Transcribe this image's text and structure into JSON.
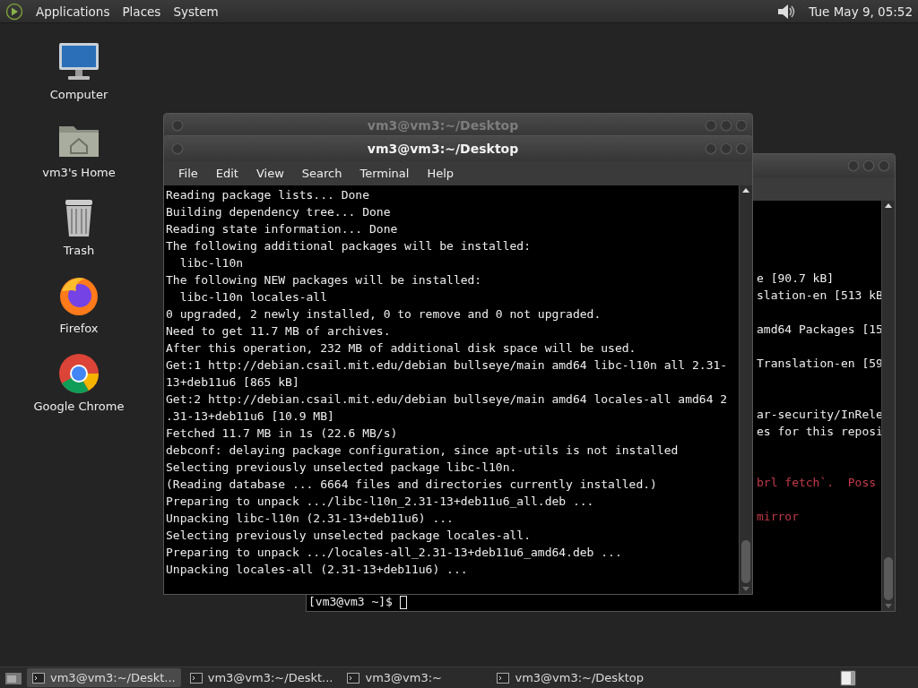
{
  "top_panel": {
    "menus": [
      "Applications",
      "Places",
      "System"
    ],
    "clock": "Tue May 9, 05:52"
  },
  "desktop_icons": [
    {
      "label": "Computer",
      "kind": "computer"
    },
    {
      "label": "vm3's Home",
      "kind": "home"
    },
    {
      "label": "Trash",
      "kind": "trash"
    },
    {
      "label": "Firefox",
      "kind": "firefox"
    },
    {
      "label": "Google Chrome",
      "kind": "chrome"
    }
  ],
  "back_terminal": {
    "lines": [
      {
        "text": "e [90.7 kB]",
        "kind": "normal"
      },
      {
        "text": "slation-en [513 kB",
        "kind": "normal"
      },
      {
        "kind": "blank"
      },
      {
        "text": "amd64 Packages [15",
        "kind": "normal"
      },
      {
        "kind": "blank"
      },
      {
        "text": "Translation-en [59",
        "kind": "normal"
      },
      {
        "kind": "blank"
      },
      {
        "kind": "blank"
      },
      {
        "text": "ar-security/InRele",
        "kind": "normal"
      },
      {
        "text": "es for this reposi",
        "kind": "normal"
      },
      {
        "kind": "blank"
      },
      {
        "kind": "blank"
      },
      {
        "text": "brl fetch`.  Poss",
        "kind": "error"
      },
      {
        "kind": "blank"
      },
      {
        "text": "mirror",
        "kind": "error"
      },
      {
        "kind": "blank"
      },
      {
        "kind": "blank"
      },
      {
        "kind": "blank"
      },
      {
        "kind": "blank"
      }
    ],
    "prompt": "[vm3@vm3 ~]$"
  },
  "middle_window": {
    "title": "vm3@vm3:~/Desktop",
    "focused": false
  },
  "front_terminal": {
    "title": "vm3@vm3:~/Desktop",
    "focused": true,
    "menu": [
      "File",
      "Edit",
      "View",
      "Search",
      "Terminal",
      "Help"
    ],
    "lines": [
      "Reading package lists... Done",
      "Building dependency tree... Done",
      "Reading state information... Done",
      "The following additional packages will be installed:",
      "  libc-l10n",
      "The following NEW packages will be installed:",
      "  libc-l10n locales-all",
      "0 upgraded, 2 newly installed, 0 to remove and 0 not upgraded.",
      "Need to get 11.7 MB of archives.",
      "After this operation, 232 MB of additional disk space will be used.",
      "Get:1 http://debian.csail.mit.edu/debian bullseye/main amd64 libc-l10n all 2.31-",
      "13+deb11u6 [865 kB]",
      "Get:2 http://debian.csail.mit.edu/debian bullseye/main amd64 locales-all amd64 2",
      ".31-13+deb11u6 [10.9 MB]",
      "Fetched 11.7 MB in 1s (22.6 MB/s)",
      "debconf: delaying package configuration, since apt-utils is not installed",
      "Selecting previously unselected package libc-l10n.",
      "(Reading database ... 6664 files and directories currently installed.)",
      "Preparing to unpack .../libc-l10n_2.31-13+deb11u6_all.deb ...",
      "Unpacking libc-l10n (2.31-13+deb11u6) ...",
      "Selecting previously unselected package locales-all.",
      "Preparing to unpack .../locales-all_2.31-13+deb11u6_amd64.deb ...",
      "Unpacking locales-all (2.31-13+deb11u6) ..."
    ]
  },
  "taskbar": {
    "items": [
      {
        "label": "vm3@vm3:~/Deskt...",
        "selected": true
      },
      {
        "label": "vm3@vm3:~/Deskt...",
        "selected": false
      },
      {
        "label": "vm3@vm3:~",
        "selected": false
      },
      {
        "label": "vm3@vm3:~/Desktop",
        "selected": false
      }
    ]
  }
}
